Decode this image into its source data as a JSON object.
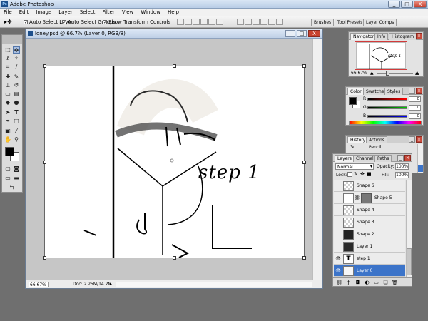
{
  "app": {
    "title": "Adobe Photoshop"
  },
  "window_controls": {
    "minimize": "_",
    "maximize": "□",
    "close": "X"
  },
  "menu": [
    "File",
    "Edit",
    "Image",
    "Layer",
    "Select",
    "Filter",
    "View",
    "Window",
    "Help"
  ],
  "options": {
    "auto_select_layer": "Auto Select Layer",
    "auto_select_groups": "Auto Select Groups",
    "show_transform": "Show Transform Controls",
    "workspace_tabs": [
      "Brushes",
      "Tool Presets",
      "Layer Comps"
    ]
  },
  "document": {
    "title": "loney.psd @ 66.7% (Layer 0, RGB/8)",
    "zoom": "66.67%",
    "doc_size": "Doc: 2.25M/14.2M",
    "canvas_text": "step 1"
  },
  "navigator": {
    "tabs": [
      "Navigator",
      "Info",
      "Histogram"
    ],
    "zoom": "66.67%"
  },
  "color": {
    "tabs": [
      "Color",
      "Swatches",
      "Styles"
    ],
    "channels": [
      {
        "label": "R",
        "value": "0"
      },
      {
        "label": "G",
        "value": "0"
      },
      {
        "label": "B",
        "value": "0"
      }
    ]
  },
  "history": {
    "tabs": [
      "History",
      "Actions"
    ],
    "item": "Pencil"
  },
  "layers": {
    "tabs": [
      "Layers",
      "Channels",
      "Paths"
    ],
    "blend_mode": "Normal",
    "opacity_label": "Opacity:",
    "opacity_value": "100%",
    "lock_label": "Lock:",
    "fill_label": "Fill:",
    "fill_value": "100%",
    "items": [
      {
        "name": "Shape 6",
        "visible": false,
        "thumb": "checker",
        "selected": false
      },
      {
        "name": "Shape 5",
        "visible": false,
        "thumb": "shape",
        "selected": false
      },
      {
        "name": "Shape 4",
        "visible": false,
        "thumb": "checker",
        "selected": false
      },
      {
        "name": "Shape 3",
        "visible": false,
        "thumb": "checker",
        "selected": false
      },
      {
        "name": "Shape 2",
        "visible": false,
        "thumb": "dark",
        "selected": false
      },
      {
        "name": "Layer 1",
        "visible": false,
        "thumb": "dark",
        "selected": false
      },
      {
        "name": "step 1",
        "visible": true,
        "thumb": "text",
        "selected": false
      },
      {
        "name": "Layer 0",
        "visible": true,
        "thumb": "light",
        "selected": true
      }
    ]
  },
  "icons": {
    "eye": "eye-icon",
    "move_tool": "move-tool-icon",
    "link": "link-icon",
    "fx": "fx-icon",
    "mask": "mask-icon",
    "adjust": "adjustment-layer-icon",
    "folder": "folder-icon",
    "new_layer": "new-layer-icon",
    "trash": "trash-icon"
  },
  "colors": {
    "accent_selected": "#3c74c9",
    "foreground": "#000000",
    "background": "#ffffff"
  }
}
